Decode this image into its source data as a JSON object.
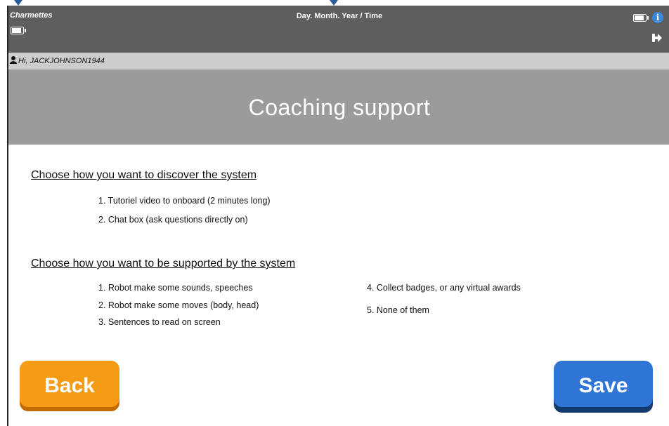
{
  "topbar": {
    "app_name": "Charmettes",
    "datetime": "Day. Month. Year / Time",
    "icons": [
      "battery-icon",
      "info-icon",
      "logout-icon"
    ]
  },
  "userbar": {
    "greeting": "Hi, JACKJOHNSON1944"
  },
  "page": {
    "title": "Coaching support"
  },
  "section1": {
    "heading": "Choose how you want to discover the system",
    "options": [
      "1. Tutoriel video to onboard (2 minutes long)",
      "2. Chat box (ask questions directly on)"
    ]
  },
  "section2": {
    "heading": "Choose how you want to be supported by the system",
    "options_left": [
      "1. Robot make some sounds, speeches",
      "2. Robot make some moves (body, head)",
      "3. Sentences to read on screen"
    ],
    "options_right": [
      "4. Collect badges, or any virtual awards",
      "5. None of them"
    ]
  },
  "buttons": {
    "back": "Back",
    "save": "Save"
  },
  "colors": {
    "topbar": "#5e5e5e",
    "userbar": "#cdcdcd",
    "titlebar": "#9b9b9b",
    "back_button": "#f59b16",
    "save_button": "#2f75d6",
    "info_icon": "#3d86d8"
  }
}
